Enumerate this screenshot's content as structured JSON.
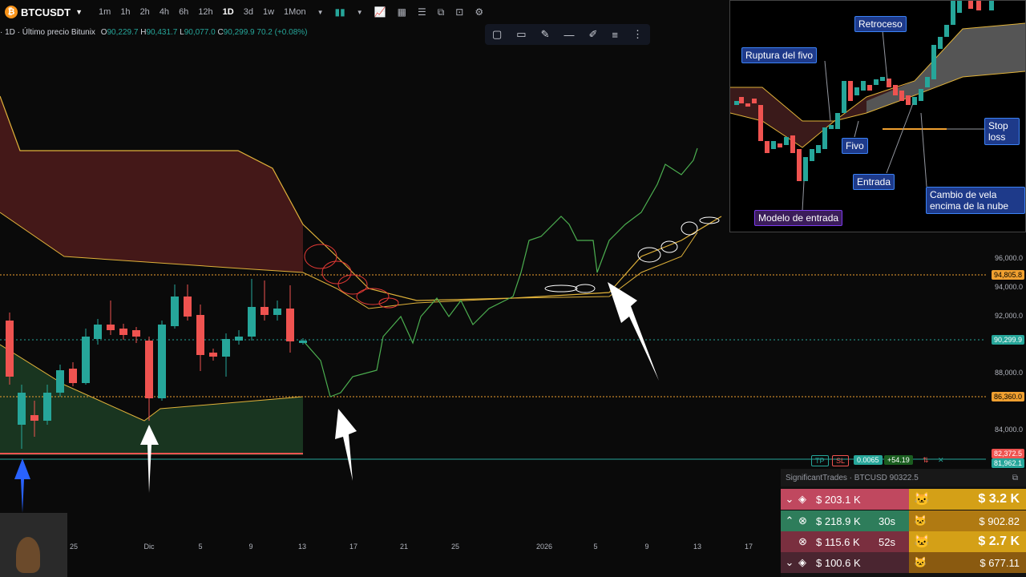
{
  "toolbar": {
    "symbol": "BTCUSDT",
    "intervals": [
      "1m",
      "1h",
      "2h",
      "4h",
      "6h",
      "12h",
      "1D",
      "3d",
      "1w",
      "1Mon"
    ],
    "active_interval": "1D"
  },
  "legend": {
    "title": "· 1D · Último precio Bitunix",
    "o_label": "O",
    "o": "90,229.7",
    "h_label": "H",
    "h": "90,431.7",
    "l_label": "L",
    "l": "90,077.0",
    "c_label": "C",
    "c": "90,299.9",
    "change": "70.2 (+0.08%)"
  },
  "price_axis": [
    "96,000.0",
    "94,000.0",
    "92,000.0",
    "88,000.0",
    "84,000.0"
  ],
  "price_tags": {
    "p1": "94,805.8",
    "p2": "90,299.9",
    "p3": "86,360.0",
    "p4": "82,372.5",
    "p5": "81,962.1"
  },
  "date_axis": [
    "25",
    "Dic",
    "5",
    "9",
    "13",
    "17",
    "21",
    "25",
    "2026",
    "5",
    "9",
    "13",
    "17"
  ],
  "position_widget": {
    "tp": "TP",
    "sl": "SL",
    "qty": "0.0065",
    "pnl": "+54.19"
  },
  "inset": {
    "labels": {
      "ruptura": "Ruptura del fivo",
      "retroceso": "Retroceso",
      "stop_loss": "Stop loss",
      "fivo": "Fivo",
      "entrada": "Entrada",
      "cambio": "Cambio de vela encima de la nube",
      "modelo": "Modelo de entrada"
    }
  },
  "trades": {
    "header": "SignificantTrades · BTCUSD 90322.5",
    "left_rows": [
      {
        "amount": "$ 203.1 K",
        "time": ""
      },
      {
        "amount": "$ 218.9 K",
        "time": "30s"
      },
      {
        "amount": "$ 115.6 K",
        "time": "52s"
      },
      {
        "amount": "$ 100.6 K",
        "time": ""
      }
    ],
    "right_rows": [
      {
        "amount": "$ 3.2 K"
      },
      {
        "amount": "$ 902.82"
      },
      {
        "amount": "$ 2.7 K"
      },
      {
        "amount": "$ 677.11"
      }
    ]
  },
  "colors": {
    "up": "#26a69a",
    "down": "#ef5350",
    "cloud_red": "#4a1a1a",
    "cloud_green": "#1b3a22",
    "kumo_line": "#e0b23a",
    "hline_orange": "#f0a030",
    "hline_green": "#26a69a"
  }
}
